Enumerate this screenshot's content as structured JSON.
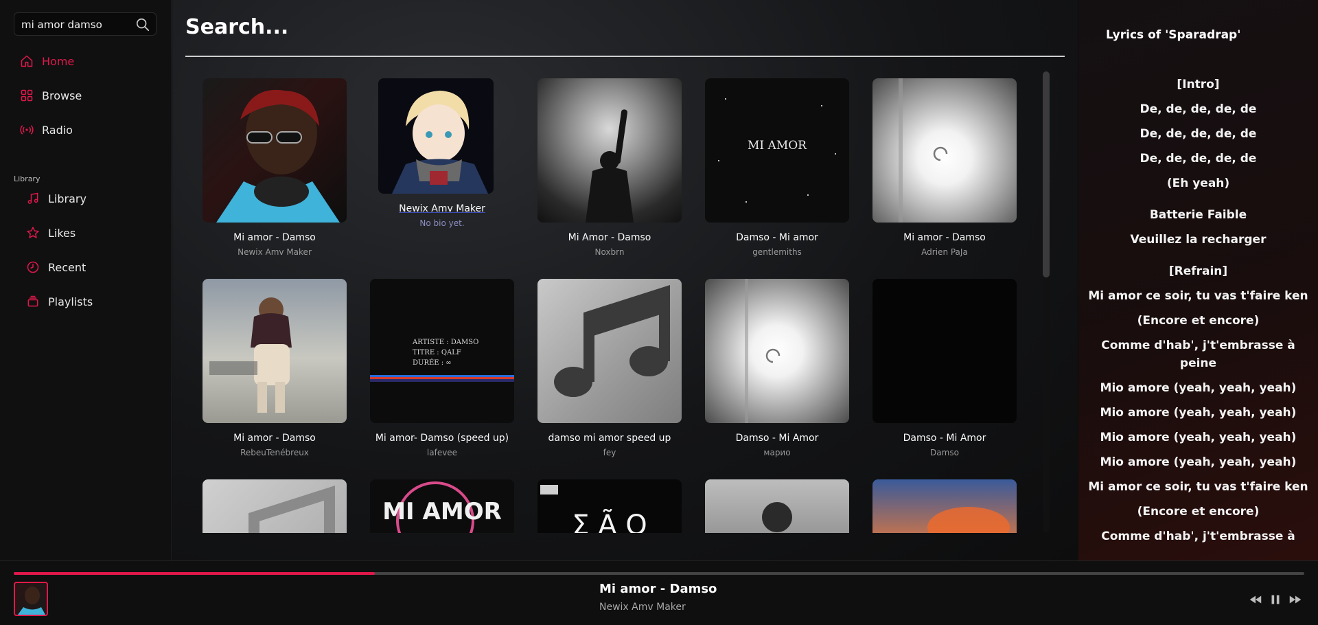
{
  "sidebar": {
    "search": {
      "value": "mi amor damso"
    },
    "nav": [
      {
        "label": "Home",
        "icon": "home-icon",
        "active": true
      },
      {
        "label": "Browse",
        "icon": "grid-icon"
      },
      {
        "label": "Radio",
        "icon": "radio-icon"
      }
    ],
    "section_label": "Library",
    "library": [
      {
        "label": "Library",
        "icon": "music-note-icon"
      },
      {
        "label": "Likes",
        "icon": "star-icon"
      },
      {
        "label": "Recent",
        "icon": "clock-icon"
      },
      {
        "label": "Playlists",
        "icon": "stack-icon"
      }
    ]
  },
  "main": {
    "title": "Search...",
    "results": [
      {
        "title": "Mi amor - Damso",
        "artist": "Newix Amv Maker"
      },
      {
        "title": "Newix Amv Maker",
        "artist": "No bio yet."
      },
      {
        "title": "Mi Amor - Damso",
        "artist": "Noxbrn"
      },
      {
        "title": "Damso - Mi amor",
        "artist": "gentlemiths"
      },
      {
        "title": "Mi amor - Damso",
        "artist": "Adrien PaJa"
      },
      {
        "title": "Mi amor - Damso",
        "artist": "RebeuTenébreux"
      },
      {
        "title": "Mi amor- Damso (speed up)",
        "artist": "lafevee"
      },
      {
        "title": "damso mi amor speed up",
        "artist": "fey"
      },
      {
        "title": "Damso - Mi Amor",
        "artist": "марио"
      },
      {
        "title": "Damso - Mi Amor",
        "artist": "Damso"
      },
      {
        "title": "",
        "artist": ""
      },
      {
        "title": "",
        "artist": ""
      },
      {
        "title": "",
        "artist": ""
      },
      {
        "title": "",
        "artist": ""
      },
      {
        "title": "",
        "artist": ""
      }
    ],
    "cover_texts": {
      "mi_amor_moon": "MI AMOR",
      "qalf_artiste": "ARTISTE : DAMSO",
      "qalf_titre": "TITRE : QALF",
      "qalf_duree": "DURÉE : ∞",
      "mi_amor_pink": "MI AMOR",
      "sao": "Σ Ã O"
    }
  },
  "lyrics": {
    "title": "Lyrics of 'Sparadrap'",
    "lines": [
      "[Intro]",
      "De, de, de, de, de",
      "De, de, de, de, de",
      "De, de, de, de, de",
      "(Eh yeah)",
      "Batterie Faible",
      "Veuillez la recharger",
      "[Refrain]",
      "Mi amor ce soir, tu vas t'faire ken",
      "(Encore et encore)",
      "Comme d'hab', j't'embrasse à",
      "peine",
      "Mio amore (yeah, yeah, yeah)",
      "Mio amore (yeah, yeah, yeah)",
      "Mio amore (yeah, yeah, yeah)",
      "Mio amore (yeah, yeah, yeah)",
      "Mi amor ce soir, tu vas t'faire ken",
      "(Encore et encore)",
      "Comme d'hab', j't'embrasse à"
    ]
  },
  "player": {
    "title": "Mi amor - Damso",
    "artist": "Newix Amv Maker",
    "progress": 0.28
  },
  "colors": {
    "accent": "#e0184a",
    "background": "#0b0b0c",
    "sidebar": "#101011"
  }
}
